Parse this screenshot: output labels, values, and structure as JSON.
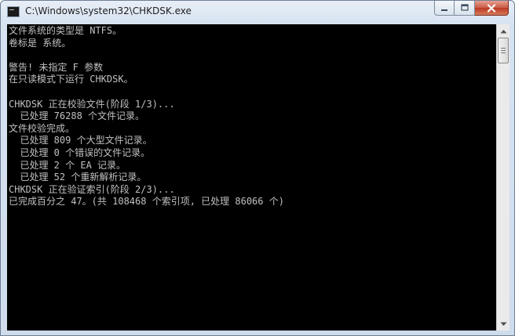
{
  "window": {
    "title": "C:\\Windows\\system32\\CHKDSK.exe",
    "accent_close": "#c8442a",
    "console_background": "#000000",
    "console_text_color": "#c0c0c0"
  },
  "console": {
    "lines": [
      "文件系统的类型是 NTFS。",
      "卷标是 系统。",
      "",
      "警告! 未指定 F 参数",
      "在只读模式下运行 CHKDSK。",
      "",
      "CHKDSK 正在校验文件(阶段 1/3)...",
      "  已处理 76288 个文件记录。",
      "文件校验完成。",
      "  已处理 809 个大型文件记录。",
      "  已处理 0 个错误的文件记录。",
      "  已处理 2 个 EA 记录。",
      "  已处理 52 个重新解析记录。",
      "CHKDSK 正在验证索引(阶段 2/3)...",
      "已完成百分之 47。(共 108468 个索引项, 已处理 86066 个)"
    ]
  },
  "icons": {
    "app": "console-icon",
    "minimize": "minimize-icon",
    "maximize": "maximize-icon",
    "close": "close-icon",
    "scroll_up": "scroll-up-arrow-icon",
    "scroll_down": "scroll-down-arrow-icon"
  }
}
